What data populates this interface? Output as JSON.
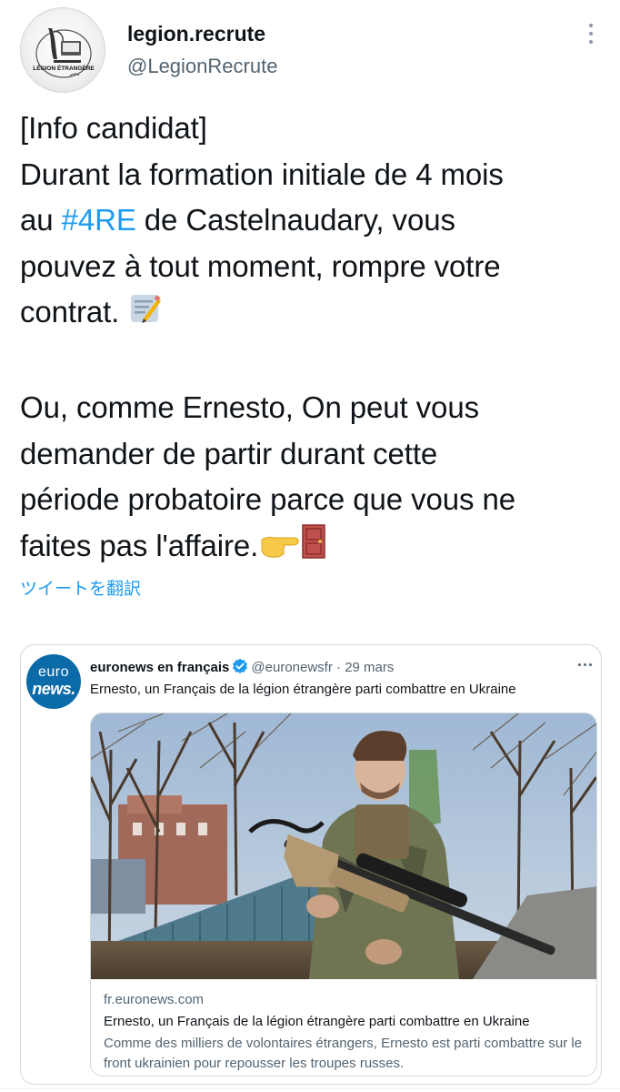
{
  "author": {
    "display_name": "legion.recrute",
    "handle": "@LegionRecrute",
    "avatar_text": "LÉGION ÉTRANGÈRE"
  },
  "tweet": {
    "part1": "[Info candidat]\nDurant la formation initiale de 4 mois\nau ",
    "hashtag": "#4RE",
    "part2": " de Castelnaudary, vous\npouvez à tout moment, rompre votre\ncontrat. ",
    "part3": "\n\nOu, comme Ernesto, On peut vous\ndemander de partir durant cette\npériode probatoire parce que vous ne\nfaites pas l'affaire.",
    "emoji_memo": "memo-emoji",
    "emoji_point": "point-right-emoji",
    "emoji_door": "door-emoji"
  },
  "translate_link": "ツイートを翻訳",
  "quote": {
    "avatar_line1": "euro",
    "avatar_line2": "news.",
    "name": "euronews en français",
    "handle": "@euronewsfr",
    "separator": " · ",
    "date": "29 mars",
    "text": "Ernesto, un Français de la légion étrangère parti combattre en Ukraine",
    "link": {
      "domain": "fr.euronews.com",
      "title": "Ernesto, un Français de la légion étrangère parti combattre en Ukraine",
      "description": "Comme des milliers de volontaires étrangers, Ernesto est parti combattre sur le front ukrainien pour repousser les troupes russes."
    }
  },
  "colors": {
    "accent": "#1d9bf0",
    "text": "#0f1419",
    "secondary": "#536471",
    "border": "#cfd9de",
    "euronews_blue": "#0b6aa8"
  },
  "icons": [
    "more-vertical-icon",
    "verified-badge-icon",
    "more-horizontal-icon"
  ]
}
